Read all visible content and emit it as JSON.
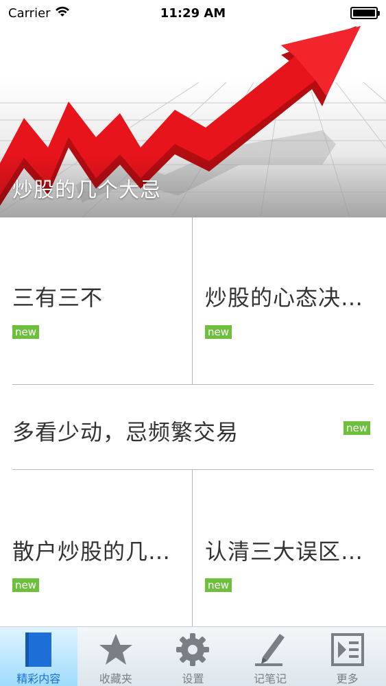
{
  "status_bar": {
    "carrier": "Carrier",
    "time": "11:29 AM"
  },
  "hero": {
    "caption": "炒股的几个大忌"
  },
  "articles": [
    {
      "title": "三有三不",
      "badge": "new"
    },
    {
      "title": "炒股的心态决…",
      "badge": "new"
    },
    {
      "title": "多看少动，忌频繁交易",
      "badge": "new"
    },
    {
      "title": "散户炒股的几…",
      "badge": "new"
    },
    {
      "title": "认清三大误区…",
      "badge": "new"
    }
  ],
  "tabbar": {
    "tabs": [
      {
        "label": "精彩内容",
        "icon": "book-icon",
        "active": true
      },
      {
        "label": "收藏夹",
        "icon": "star-icon",
        "active": false
      },
      {
        "label": "设置",
        "icon": "gear-icon",
        "active": false
      },
      {
        "label": "记笔记",
        "icon": "pen-icon",
        "active": false
      },
      {
        "label": "更多",
        "icon": "more-list-icon",
        "active": false
      }
    ],
    "active_color": "#1c6fd6",
    "inactive_color": "#7a7f85"
  },
  "colors": {
    "badge": "#6fbf3f",
    "arrow": "#e8141c"
  }
}
